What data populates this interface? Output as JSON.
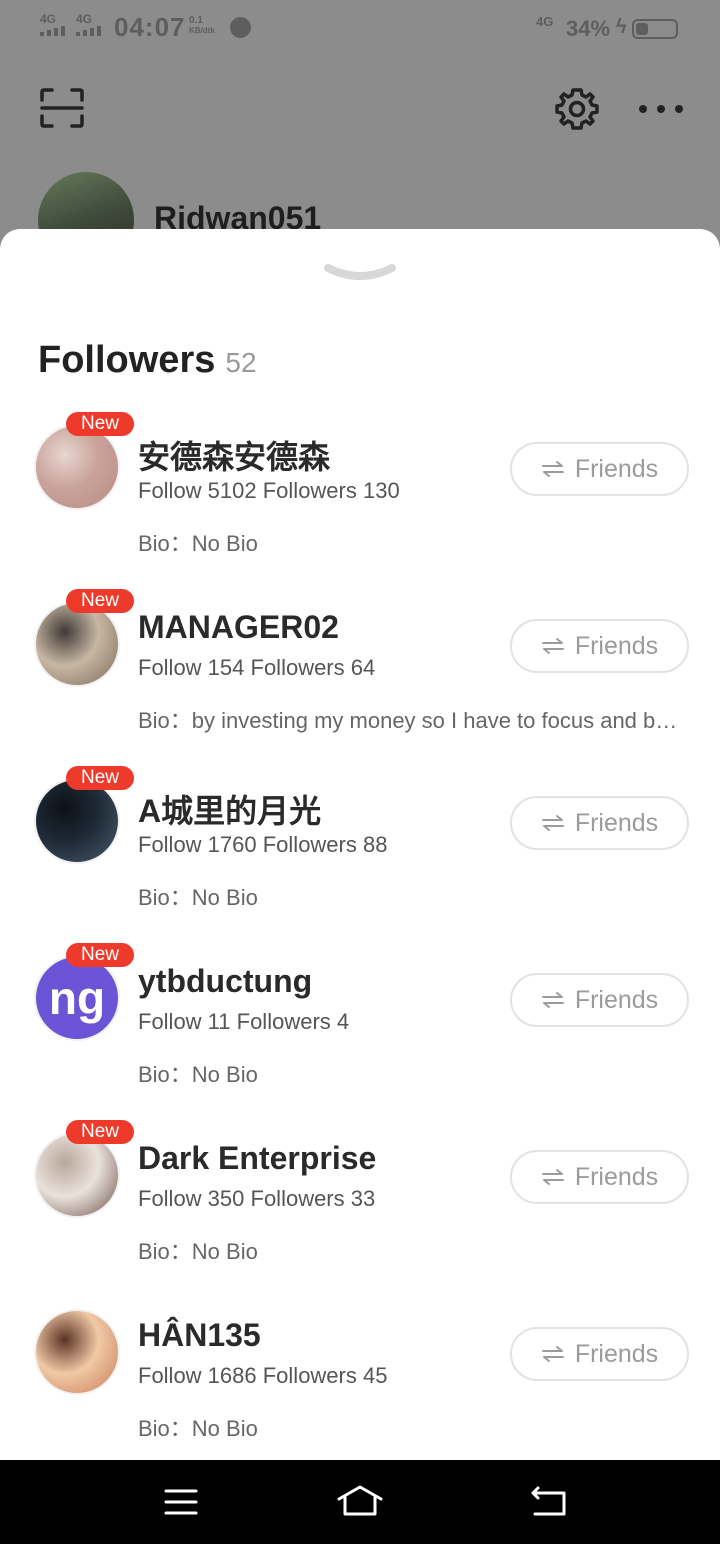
{
  "status_bar": {
    "net1": "4G",
    "net2": "4G",
    "time": "04:07",
    "speed_value": "0.1",
    "speed_unit": "KB/dtk",
    "net_right": "4G",
    "battery": "34%"
  },
  "profile": {
    "username": "Ridwan051"
  },
  "sheet": {
    "title": "Followers",
    "count": "52"
  },
  "followers": [
    {
      "name": "安德森安德森",
      "stats": "Follow 5102 Followers 130",
      "bio": "Bio：No Bio",
      "badge": "New",
      "button": "Friends",
      "avatar_colors": [
        "#c9a39a",
        "#b98b86",
        "#e7d6d0"
      ]
    },
    {
      "name": "MANAGER02",
      "stats": "Follow 154 Followers 64",
      "bio": "Bio：by investing my money so I have to focus and be patient",
      "badge": "New",
      "button": "Friends",
      "avatar_colors": [
        "#c7b7a3",
        "#7d6a59",
        "#3f3a36"
      ]
    },
    {
      "name": "A城里的月光",
      "stats": "Follow 1760 Followers 88",
      "bio": "Bio：No Bio",
      "badge": "New",
      "button": "Friends",
      "avatar_colors": [
        "#1e2a36",
        "#4a5c70",
        "#0d1116"
      ]
    },
    {
      "name": "ytbductung",
      "stats": "Follow 11 Followers 4",
      "bio": "Bio：No Bio",
      "badge": "New",
      "button": "Friends",
      "avatar_initials": "ng",
      "avatar_colors": [
        "#6b55d6",
        "#6b55d6",
        "#6b55d6"
      ]
    },
    {
      "name": "Dark Enterprise",
      "stats": "Follow 350 Followers 33",
      "bio": "Bio：No Bio",
      "badge": "New",
      "button": "Friends",
      "avatar_colors": [
        "#e9e2dc",
        "#6d5148",
        "#b9a79a"
      ]
    },
    {
      "name": "HÂN135",
      "stats": "Follow 1686 Followers 45",
      "bio": "Bio：No Bio",
      "badge": "",
      "button": "Friends",
      "avatar_colors": [
        "#f1c9a6",
        "#c77b55",
        "#5b3324"
      ]
    }
  ]
}
